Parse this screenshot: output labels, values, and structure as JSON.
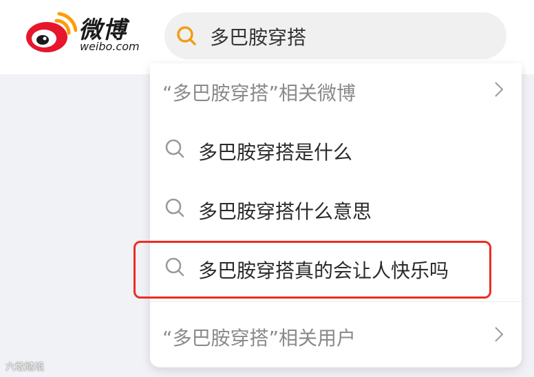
{
  "header": {
    "logo_cn": "微博",
    "logo_en": "weibo.com",
    "logo_icon": "weibo-eye-icon"
  },
  "search": {
    "value": "多巴胺穿搭",
    "icon": "search-icon",
    "icon_color": "#f39c12"
  },
  "dropdown": {
    "related_weibo": "“多巴胺穿搭”相关微博",
    "suggestions": [
      {
        "label": "多巴胺穿搭是什么"
      },
      {
        "label": "多巴胺穿搭什么意思"
      },
      {
        "label": "多巴胺穿搭真的会让人快乐吗"
      }
    ],
    "related_users": "“多巴胺穿搭”相关用户"
  },
  "highlight": {
    "color": "#ee2b24"
  },
  "watermark": "六敢踏境",
  "colors": {
    "brand_red": "#e6162d",
    "brand_orange": "#ff9c00"
  }
}
